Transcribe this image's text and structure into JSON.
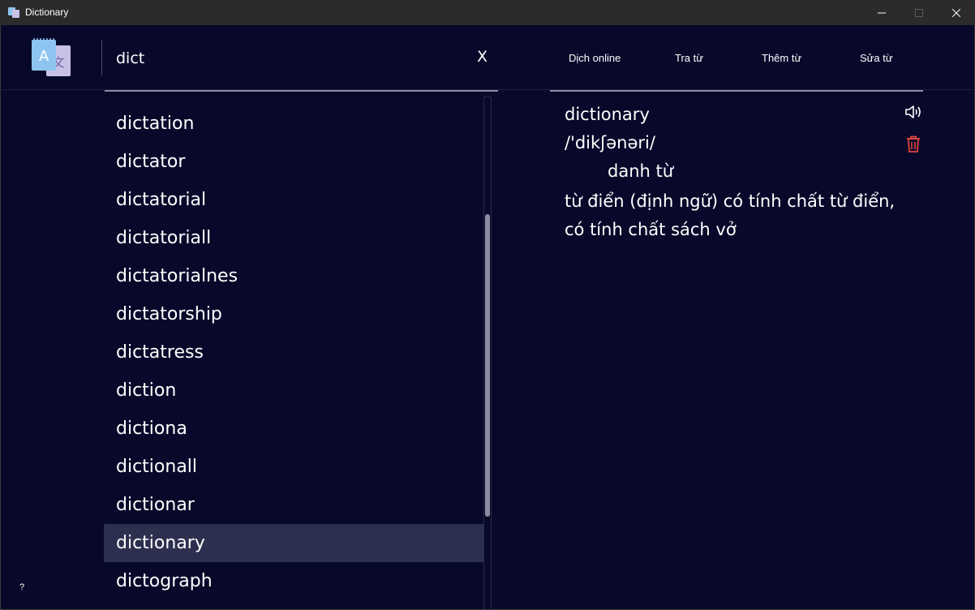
{
  "window": {
    "title": "Dictionary"
  },
  "search": {
    "value": "dict",
    "clear_label": "X"
  },
  "nav": [
    {
      "label": "Dịch online"
    },
    {
      "label": "Tra từ"
    },
    {
      "label": "Thêm từ"
    },
    {
      "label": "Sửa từ"
    }
  ],
  "wordlist": {
    "items": [
      {
        "label": "dictation"
      },
      {
        "label": "dictator"
      },
      {
        "label": "dictatorial"
      },
      {
        "label": "dictatoriall"
      },
      {
        "label": "dictatorialnes"
      },
      {
        "label": "dictatorship"
      },
      {
        "label": "dictatress"
      },
      {
        "label": "diction"
      },
      {
        "label": "dictiona"
      },
      {
        "label": "dictionall"
      },
      {
        "label": "dictionar"
      },
      {
        "label": "dictionary"
      },
      {
        "label": "dictograph"
      }
    ],
    "selected": "dictionary"
  },
  "definition": {
    "word": "dictionary",
    "phonetic": "/'dikʃənəri/",
    "part_of_speech": "danh từ",
    "meaning": "từ điển (định ngữ) có tính chất từ điển, có tính chất sách vở"
  },
  "icons": {
    "app": "dictionary-app-icon",
    "speaker": "speaker-icon",
    "delete": "trash-icon"
  },
  "colors": {
    "background": "#08092a",
    "selected_row": "#2d2f4f",
    "delete_icon": "#e0463c"
  },
  "help": {
    "label": "?"
  }
}
